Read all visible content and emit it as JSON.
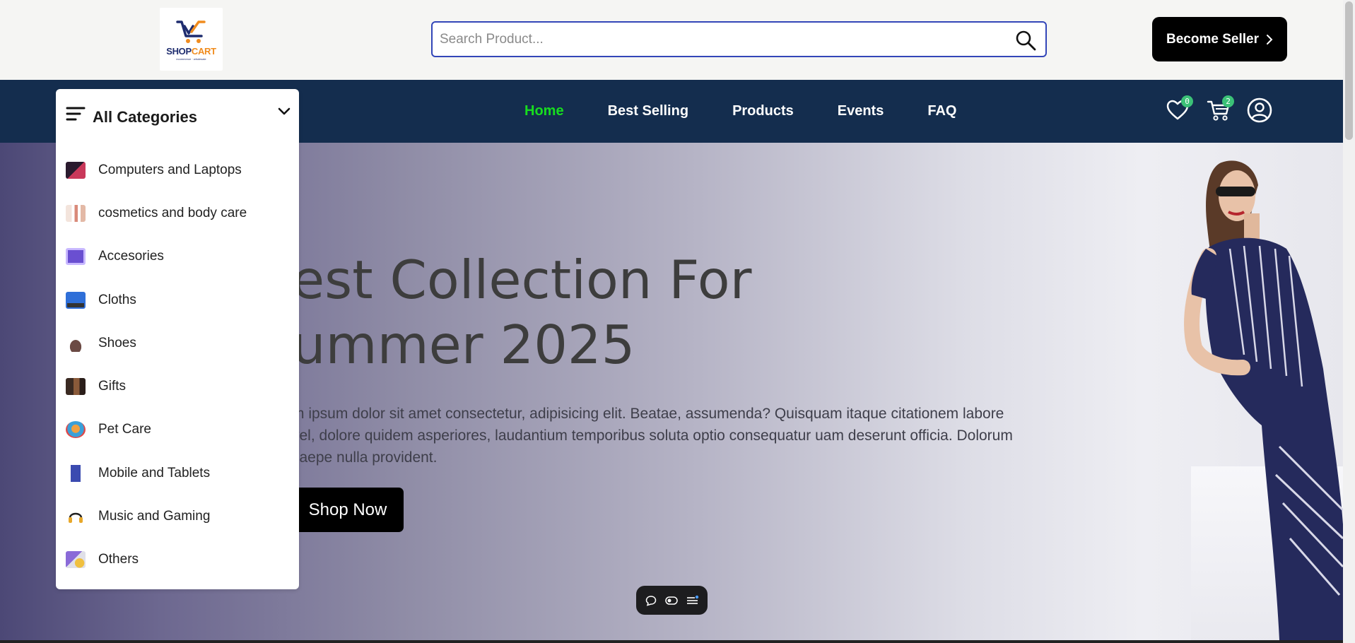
{
  "header": {
    "logo": {
      "brand_main": "SHOP",
      "brand_accent": "CART",
      "tagline": "ecommerce · wholesale",
      "icon": "cart-icon"
    },
    "search": {
      "placeholder": "Search Product...",
      "value": "",
      "icon": "search-icon"
    },
    "seller_button": {
      "label": "Become Seller",
      "icon": "chevron-right-icon"
    }
  },
  "nav": {
    "links": [
      {
        "label": "Home",
        "active": true
      },
      {
        "label": "Best Selling",
        "active": false
      },
      {
        "label": "Products",
        "active": false
      },
      {
        "label": "Events",
        "active": false
      },
      {
        "label": "FAQ",
        "active": false
      }
    ],
    "wishlist": {
      "icon": "heart-icon",
      "count": "0"
    },
    "cart": {
      "icon": "cart-icon",
      "count": "2"
    },
    "profile": {
      "icon": "user-circle-icon"
    },
    "colors": {
      "bar": "#142d4e",
      "active_link": "#17dd1f",
      "badge": "#3bc177"
    }
  },
  "categories": {
    "title": "All Categories",
    "items": [
      {
        "label": "Computers and Laptops",
        "icon": "laptop-icon"
      },
      {
        "label": "cosmetics and body care",
        "icon": "cosmetics-icon"
      },
      {
        "label": "Accesories",
        "icon": "accessories-icon"
      },
      {
        "label": "Cloths",
        "icon": "clothing-icon"
      },
      {
        "label": "Shoes",
        "icon": "shoe-icon"
      },
      {
        "label": "Gifts",
        "icon": "gift-icon"
      },
      {
        "label": "Pet Care",
        "icon": "pet-icon"
      },
      {
        "label": "Mobile and Tablets",
        "icon": "mobile-icon"
      },
      {
        "label": "Music and Gaming",
        "icon": "headphones-icon"
      },
      {
        "label": "Others",
        "icon": "others-icon"
      }
    ]
  },
  "hero": {
    "title": "est Collection For\nummer 2025",
    "description": "m ipsum dolor sit amet consectetur, adipisicing elit. Beatae, assumenda? Quisquam itaque citationem labore vel, dolore quidem asperiores, laudantium temporibus soluta optio consequatur uam deserunt officia. Dolorum saepe nulla provident.",
    "cta": "Shop Now"
  },
  "float_toolbar": {
    "icons": [
      "comment-icon",
      "toggle-icon",
      "menu-lines-icon"
    ]
  }
}
